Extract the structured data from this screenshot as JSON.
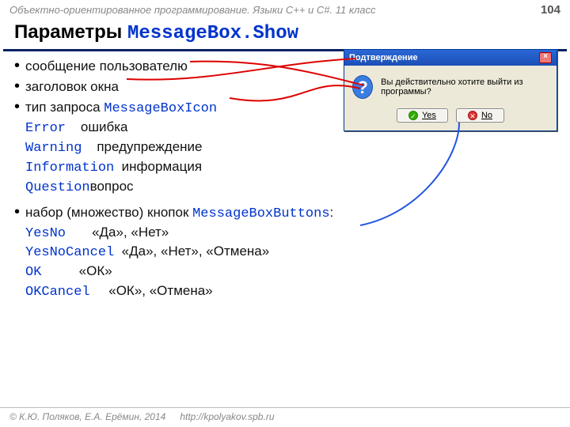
{
  "header": {
    "course": "Объектно-ориентированное программирование. Языки C++ и C#. 11 класс",
    "page": "104"
  },
  "title": {
    "prefix": "Параметры ",
    "code": "MessageBox.Show"
  },
  "bullets": {
    "b1": "сообщение пользователю",
    "b2": "заголовок окна",
    "b3_prefix": "тип запроса ",
    "b3_code": "MessageBoxIcon",
    "icons": {
      "r1_code": "Error",
      "r1_ru": "ошибка",
      "r2_code": "Warning",
      "r2_ru": "предупреждение",
      "r3_code": "Information",
      "r3_ru": "информация",
      "r4_code": "Question",
      "r4_ru": "вопрос"
    },
    "b4_prefix": "набор (множество) кнопок ",
    "b4_code": "MessageBoxButtons",
    "b4_suffix": ":",
    "btns": {
      "r1_code": "YesNo",
      "r1_ru": "«Да», «Нет»",
      "r2_code": "YesNoCancel",
      "r2_ru": "«Да», «Нет», «Отмена»",
      "r3_code": "OK",
      "r3_ru": "«ОК»",
      "r4_code": "OKCancel",
      "r4_ru": "«ОК», «Отмена»"
    }
  },
  "dialog": {
    "title": "Подтверждение",
    "message": "Вы действительно хотите выйти из программы?",
    "yes": "Yes",
    "no": "No",
    "icon_char": "?"
  },
  "footer": {
    "copyright": "© К.Ю. Поляков, Е.А. Ерёмин, 2014",
    "url": "http://kpolyakov.spb.ru"
  }
}
